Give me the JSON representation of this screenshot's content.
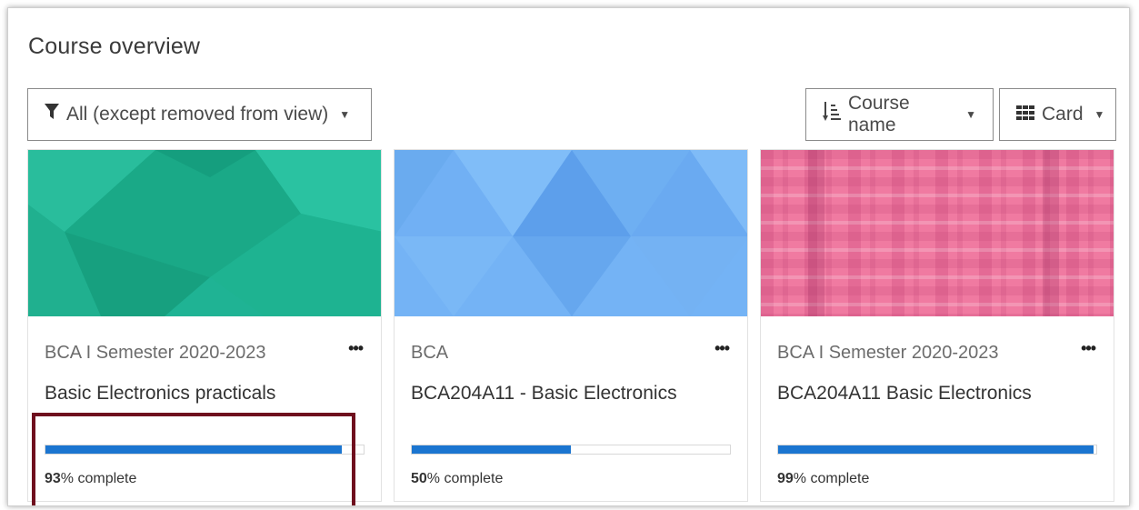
{
  "header": {
    "title": "Course overview"
  },
  "toolbar": {
    "filter_label": "All (except removed from view)",
    "sort_label": "Course name",
    "view_label": "Card"
  },
  "courses": [
    {
      "category": "BCA I Semester 2020-2023",
      "name": "Basic Electronics practicals",
      "progress": 93,
      "progress_suffix": "% complete",
      "image_color": "#1fb394"
    },
    {
      "category": "BCA",
      "name": "BCA204A11 - Basic Electronics",
      "progress": 50,
      "progress_suffix": "% complete",
      "image_color": "#74b3f5"
    },
    {
      "category": "BCA I Semester 2020-2023",
      "name": "BCA204A11 Basic Electronics",
      "progress": 99,
      "progress_suffix": "% complete",
      "image_color": "#f07aa1"
    }
  ],
  "colors": {
    "progress": "#1b75d0",
    "highlight": "#6f0f1e"
  },
  "icons": {
    "filter": "filter-icon",
    "sort": "sort-icon",
    "view": "grid-icon",
    "menu": "ellipsis-icon"
  }
}
